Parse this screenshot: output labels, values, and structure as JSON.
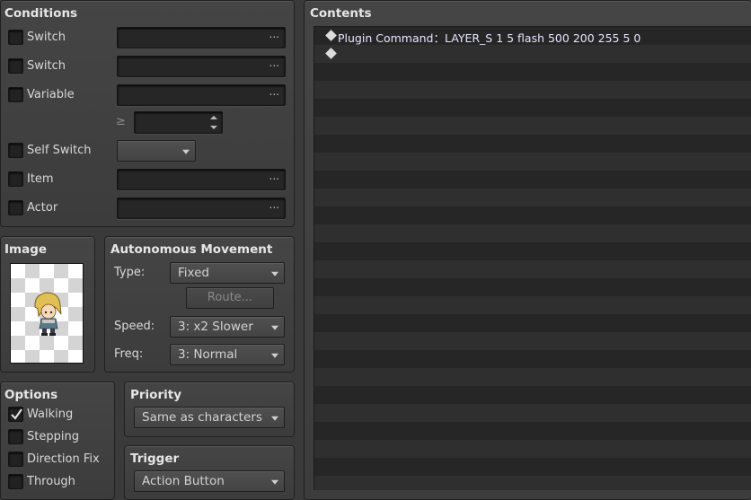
{
  "conditions": {
    "title": "Conditions",
    "rows": [
      {
        "label": "Switch"
      },
      {
        "label": "Switch"
      },
      {
        "label": "Variable"
      },
      {
        "label": "Self Switch"
      },
      {
        "label": "Item"
      },
      {
        "label": "Actor"
      }
    ],
    "ellipsis": "···",
    "gte_symbol": "≥"
  },
  "image": {
    "title": "Image"
  },
  "movement": {
    "title": "Autonomous Movement",
    "type_label": "Type:",
    "type_value": "Fixed",
    "route_label": "Route...",
    "speed_label": "Speed:",
    "speed_value": "3: x2 Slower",
    "freq_label": "Freq:",
    "freq_value": "3: Normal"
  },
  "options": {
    "title": "Options",
    "items": [
      {
        "label": "Walking",
        "checked": true
      },
      {
        "label": "Stepping",
        "checked": false
      },
      {
        "label": "Direction Fix",
        "checked": false
      },
      {
        "label": "Through",
        "checked": false
      }
    ]
  },
  "priority": {
    "title": "Priority",
    "value": "Same as characters"
  },
  "trigger": {
    "title": "Trigger",
    "value": "Action Button"
  },
  "contents": {
    "title": "Contents",
    "lines": [
      "Plugin Command：LAYER_S 1 5 flash 500 200 255 5 0",
      ""
    ]
  },
  "colors": {
    "panel": "#3c3c3c",
    "field": "#262626",
    "text": "#d8d8d8"
  }
}
